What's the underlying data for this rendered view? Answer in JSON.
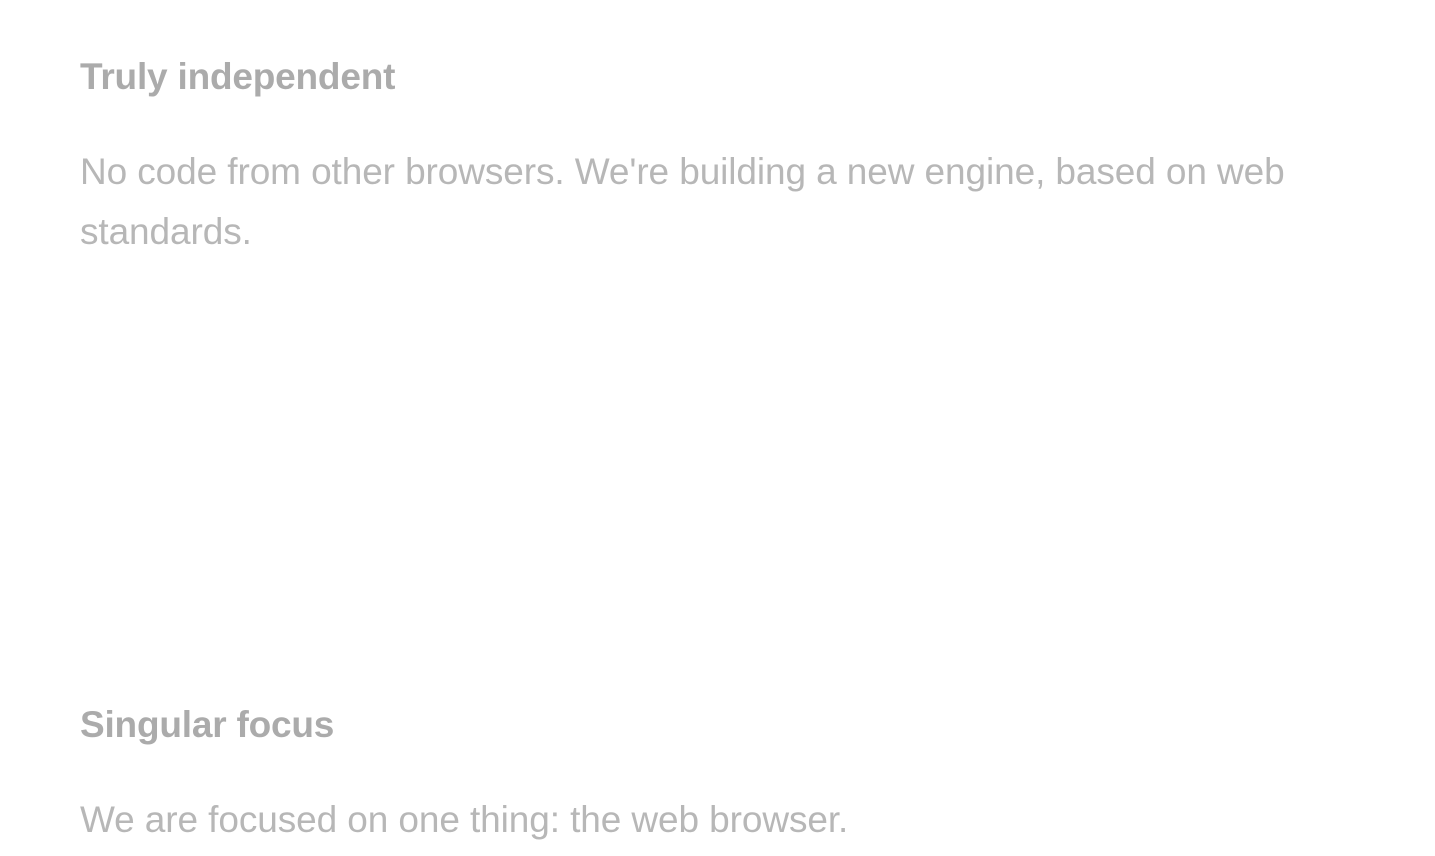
{
  "features": [
    {
      "title": "Truly independent",
      "text": "No code from other browsers. We're building a new engine, based on web standards."
    },
    {
      "title": "Singular focus",
      "text": "We are focused on one thing: the web browser."
    }
  ],
  "colors": {
    "title": "#ababab",
    "body": "#b7b7b7",
    "background": "#ffffff"
  }
}
